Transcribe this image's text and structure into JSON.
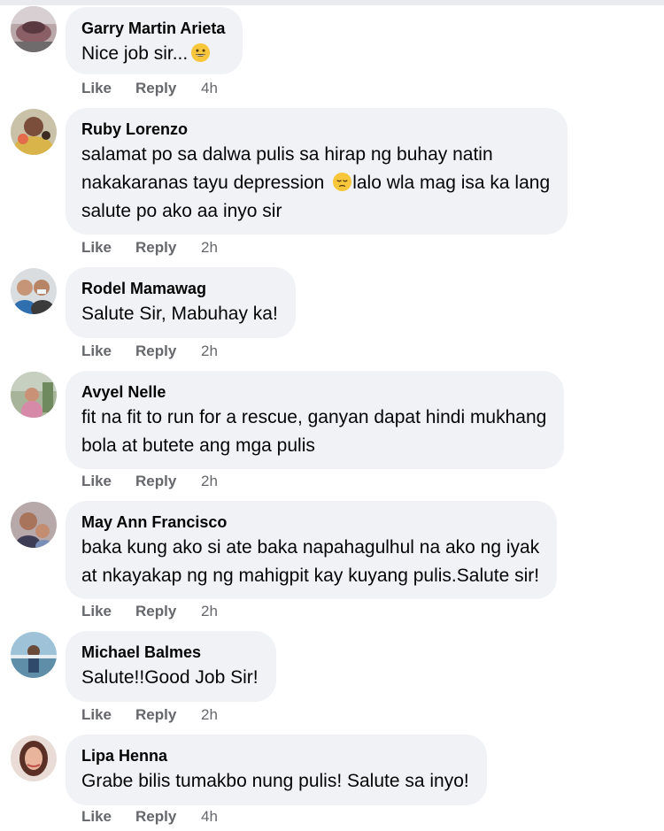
{
  "actions": {
    "like_label": "Like",
    "reply_label": "Reply"
  },
  "comments": [
    {
      "author": "Garry Martin Arieta",
      "lines": [
        "Nice job sir..."
      ],
      "emoji": "grinning-face-emoji",
      "time": "4h"
    },
    {
      "author": "Ruby Lorenzo",
      "lines": [
        "salamat po sa dalwa pulis sa hirap ng buhay natin",
        "nakakaranas tayu depression",
        "lalo wla mag isa ka lang",
        "salute po ako aa inyo sir"
      ],
      "emoji": "pensive-face-emoji",
      "time": "2h"
    },
    {
      "author": "Rodel Mamawag",
      "lines": [
        "Salute Sir, Mabuhay ka!"
      ],
      "time": "2h"
    },
    {
      "author": "Avyel Nelle",
      "lines": [
        "fit na fit to run for a rescue, ganyan dapat hindi mukhang",
        "bola at butete ang mga pulis"
      ],
      "time": "2h"
    },
    {
      "author": "May Ann Francisco",
      "lines": [
        "baka kung ako si ate baka napahagulhul na ako ng iyak",
        "at nkayakap ng ng mahigpit kay kuyang pulis.Salute sir!"
      ],
      "time": "2h"
    },
    {
      "author": "Michael Balmes",
      "lines": [
        "Salute!!Good Job Sir!"
      ],
      "time": "2h"
    },
    {
      "author": "Lipa Henna",
      "lines": [
        "Grabe bilis tumakbo nung pulis! Salute sa inyo!"
      ],
      "time": "4h"
    }
  ]
}
